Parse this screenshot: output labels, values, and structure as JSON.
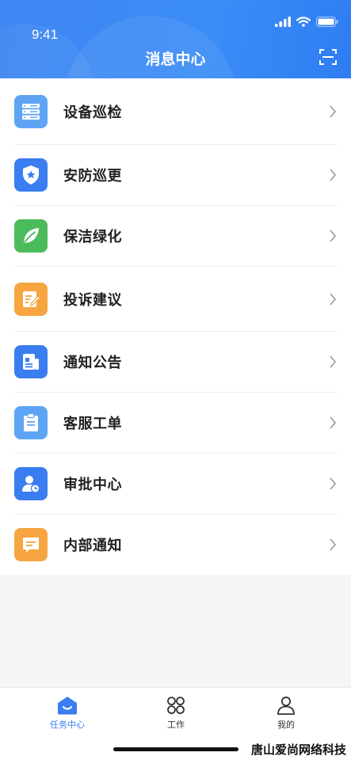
{
  "status_bar": {
    "time": "9:41"
  },
  "header": {
    "title": "消息中心"
  },
  "colors": {
    "accent": "#3a7df0",
    "green": "#4cbb5c",
    "orange": "#f6a540",
    "lightblue": "#5ea4f5"
  },
  "menu": [
    {
      "label": "设备巡检",
      "icon": "server-icon"
    },
    {
      "label": "安防巡更",
      "icon": "shield-icon"
    },
    {
      "label": "保洁绿化",
      "icon": "leaf-icon"
    },
    {
      "label": "投诉建议",
      "icon": "edit-note-icon"
    },
    {
      "label": "通知公告",
      "icon": "document-icon"
    },
    {
      "label": "客服工单",
      "icon": "clipboard-icon"
    },
    {
      "label": "审批中心",
      "icon": "user-clock-icon"
    },
    {
      "label": "内部通知",
      "icon": "message-icon"
    }
  ],
  "tabbar": [
    {
      "label": "任务中心",
      "icon": "home-icon",
      "active": true
    },
    {
      "label": "工作",
      "icon": "grid-icon",
      "active": false
    },
    {
      "label": "我的",
      "icon": "profile-icon",
      "active": false
    }
  ],
  "watermark": "唐山爱尚网络科技"
}
